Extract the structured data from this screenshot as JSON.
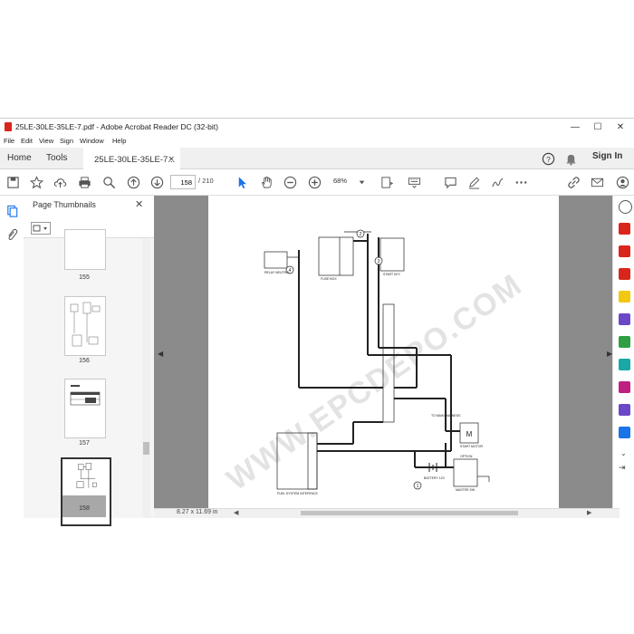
{
  "window": {
    "title": "25LE-30LE-35LE-7.pdf - Adobe Acrobat Reader DC (32-bit)",
    "minimize": "—",
    "maximize": "☐",
    "close": "✕"
  },
  "menu": [
    "File",
    "Edit",
    "View",
    "Sign",
    "Window",
    "Help"
  ],
  "tabs": {
    "home": "Home",
    "tools": "Tools",
    "doc": "25LE-30LE-35LE-7...",
    "doc_close": "×",
    "sign_in": "Sign In"
  },
  "toolbar": {
    "current_page": "158",
    "total_pages": "/ 210",
    "zoom": "68%"
  },
  "panel": {
    "title": "Page Thumbnails",
    "close": "✕",
    "thumbs": [
      {
        "label": "155"
      },
      {
        "label": "156"
      },
      {
        "label": "157"
      },
      {
        "label": "158"
      }
    ]
  },
  "status": {
    "page_size": "8.27 x 11.69 in"
  },
  "diagram": {
    "fuse_box": "FUSE BOX",
    "relay_neutral": "RELAY\nNEUTRAL",
    "start_key": "START KEY",
    "start_motor": "START MOTOR",
    "battery": "BATTERY\n12V",
    "master_sw": "MASTER SW",
    "option": "OPTION",
    "fuel_interface": "FUEL SYSTEM INTERFACE",
    "to_main_harness": "TO MAIN HARNESS",
    "motor_label": "M",
    "watermark": "WWW.EPCDEPO.COM",
    "callouts": [
      "1",
      "2",
      "3",
      "4"
    ]
  },
  "colors": {
    "accent": "#1a73e8",
    "pdf_red": "#d9261c",
    "viewer_bg": "#8b8b8b"
  }
}
